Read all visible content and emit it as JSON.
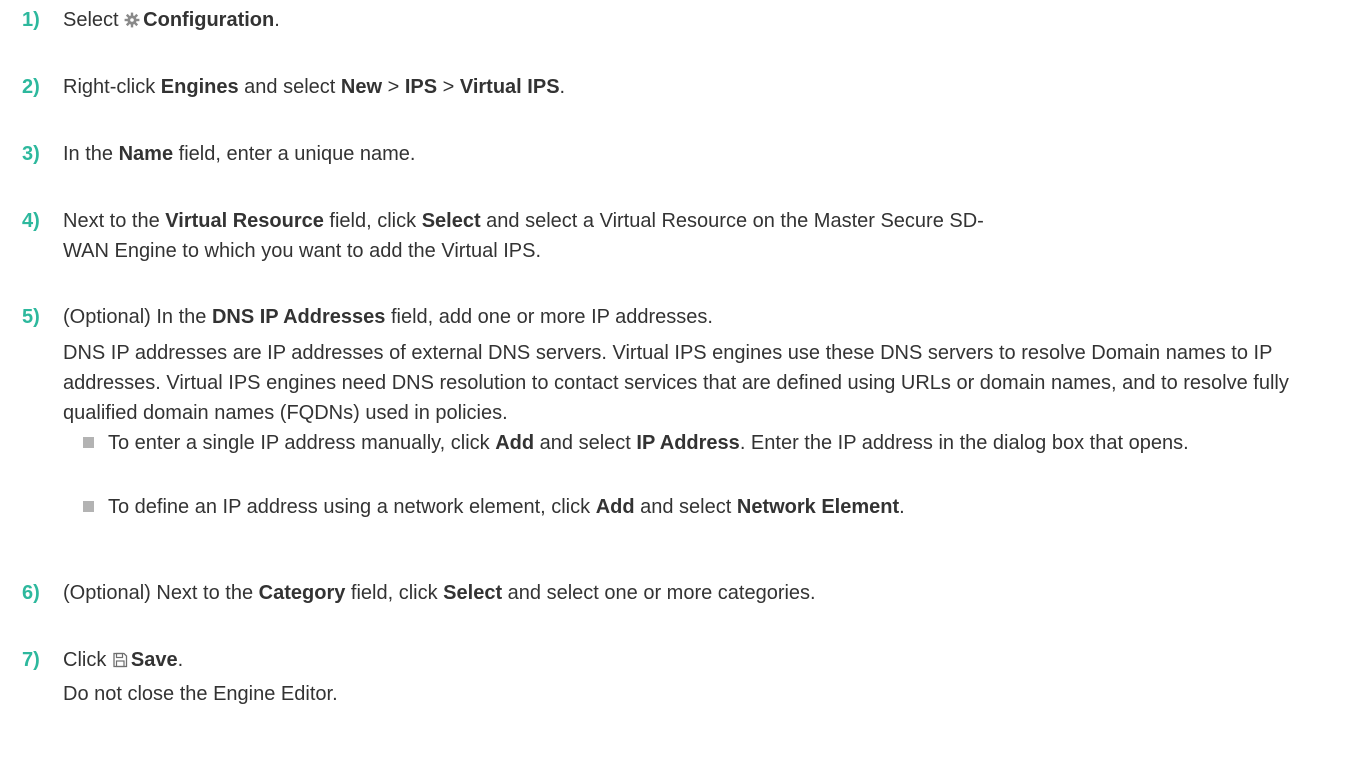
{
  "steps": [
    {
      "num": "1)",
      "t1": "Select ",
      "icon": "gear-icon",
      "b1": "Configuration",
      "t2": "."
    },
    {
      "num": "2)",
      "t1": "Right-click ",
      "b1": "Engines",
      "t2": " and select ",
      "b2": "New",
      "t3": " > ",
      "b3": "IPS",
      "t4": " > ",
      "b4": "Virtual IPS",
      "t5": "."
    },
    {
      "num": "3)",
      "t1": "In the ",
      "b1": "Name",
      "t2": " field, enter a unique name."
    },
    {
      "num": "4)",
      "t1": "Next to the ",
      "b1": "Virtual Resource",
      "t2": " field, click ",
      "b2": "Select",
      "t3": " and select a Virtual Resource on the Master Secure SD-",
      "t4": "WAN Engine to which you want to add the Virtual IPS."
    },
    {
      "num": "5)",
      "t1": "(Optional) In the ",
      "b1": "DNS IP Addresses",
      "t2": " field, add one or more IP addresses.",
      "para": "DNS IP addresses are IP addresses of external DNS servers. Virtual IPS engines use these DNS servers to resolve Domain names to IP addresses. Virtual IPS engines need DNS resolution to contact services that are defined using URLs or domain names, and to resolve fully qualified domain names (FQDNs) used in policies.",
      "bullets": [
        {
          "t1": "To enter a single IP address manually, click ",
          "b1": "Add",
          "t2": " and select ",
          "b2": "IP Address",
          "t3": ". Enter the IP address in the dialog box that opens."
        },
        {
          "t1": "To define an IP address using a network element, click ",
          "b1": "Add",
          "t2": " and select ",
          "b2": "Network Element",
          "t3": "."
        }
      ]
    },
    {
      "num": "6)",
      "t1": "(Optional) Next to the ",
      "b1": "Category",
      "t2": " field, click ",
      "b2": "Select",
      "t3": " and select one or more categories."
    },
    {
      "num": "7)",
      "t1": "Click ",
      "icon": "save-icon",
      "b1": "Save",
      "t2": ".",
      "t3": "Do not close the Engine Editor."
    }
  ]
}
